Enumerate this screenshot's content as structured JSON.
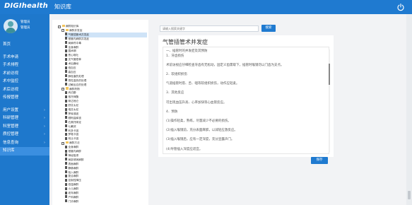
{
  "header": {
    "logo": "DIGIhealth",
    "title": "知识库",
    "power_icon": "power-icon"
  },
  "user": {
    "name": "管理员",
    "role": "管理员"
  },
  "sidebar": {
    "items": [
      {
        "label": "首页",
        "chevron": "",
        "active": false
      },
      {
        "label": "手术申请",
        "chevron": "",
        "active": false
      },
      {
        "label": "手术排程",
        "chevron": "",
        "active": false
      },
      {
        "label": "术前访视",
        "chevron": "",
        "active": false
      },
      {
        "label": "术中监控",
        "chevron": "",
        "active": false
      },
      {
        "label": "术后访视",
        "chevron": "",
        "active": false
      },
      {
        "label": "传报管理",
        "chevron": "",
        "active": false
      },
      {
        "label": "用户设置",
        "chevron": "›",
        "active": false
      },
      {
        "label": "科研管理",
        "chevron": "›",
        "active": false
      },
      {
        "label": "科室管理",
        "chevron": "›",
        "active": false
      },
      {
        "label": "质控管理",
        "chevron": "›",
        "active": false
      },
      {
        "label": "信息查询",
        "chevron": "›",
        "active": false
      },
      {
        "label": "知识库",
        "chevron": "",
        "active": true
      }
    ]
  },
  "tree": {
    "rows": [
      {
        "indent": 0,
        "icon": "box",
        "label": "麻醉知识库",
        "selected": false
      },
      {
        "indent": 1,
        "icon": "box",
        "label": "麻醉并发症",
        "selected": false
      },
      {
        "indent": 2,
        "icon": "doc",
        "label": "气管插管术并发症",
        "selected": true
      },
      {
        "indent": 2,
        "icon": "doc",
        "label": "椎管内麻醉并发症",
        "selected": false
      },
      {
        "indent": 2,
        "icon": "doc",
        "label": "局麻药中毒",
        "selected": false
      },
      {
        "indent": 2,
        "icon": "doc",
        "label": "全身麻醉",
        "selected": false
      },
      {
        "indent": 2,
        "icon": "doc",
        "label": "围术期",
        "selected": false
      },
      {
        "indent": 2,
        "icon": "doc",
        "label": "恶心呕吐",
        "selected": false
      },
      {
        "indent": 2,
        "icon": "doc",
        "label": "支气管痉挛",
        "selected": false
      },
      {
        "indent": 2,
        "icon": "doc",
        "label": "术后躁动",
        "selected": false
      },
      {
        "indent": 2,
        "icon": "doc",
        "label": "低血压",
        "selected": false
      },
      {
        "indent": 2,
        "icon": "doc",
        "label": "高血压",
        "selected": false
      },
      {
        "indent": 2,
        "icon": "doc",
        "label": "肺栓塞的处理",
        "selected": false
      },
      {
        "indent": 2,
        "icon": "doc",
        "label": "恶性高热的处理",
        "selected": false
      },
      {
        "indent": 2,
        "icon": "doc",
        "label": "过敏反应的处理",
        "selected": false
      },
      {
        "indent": 1,
        "icon": "box",
        "label": "麻醉药物",
        "selected": false
      },
      {
        "indent": 2,
        "icon": "doc",
        "label": "丙泊酚",
        "selected": false
      },
      {
        "indent": 2,
        "icon": "doc",
        "label": "依托咪酯",
        "selected": false
      },
      {
        "indent": 2,
        "icon": "doc",
        "label": "咪达唑仑",
        "selected": false
      },
      {
        "indent": 2,
        "icon": "doc",
        "label": "舒芬太尼",
        "selected": false
      },
      {
        "indent": 2,
        "icon": "doc",
        "label": "瑞芬太尼",
        "selected": false
      },
      {
        "indent": 2,
        "icon": "doc",
        "label": "罗库溴铵",
        "selected": false
      },
      {
        "indent": 2,
        "icon": "doc",
        "label": "顺阿曲库铵",
        "selected": false
      },
      {
        "indent": 2,
        "icon": "doc",
        "label": "右美托咪定",
        "selected": false
      },
      {
        "indent": 2,
        "icon": "doc",
        "label": "七氟烷",
        "selected": false
      },
      {
        "indent": 2,
        "icon": "doc",
        "label": "利多卡因",
        "selected": false
      },
      {
        "indent": 2,
        "icon": "doc",
        "label": "罗哌卡因",
        "selected": false
      },
      {
        "indent": 2,
        "icon": "doc",
        "label": "布比卡因",
        "selected": false
      },
      {
        "indent": 1,
        "icon": "box",
        "label": "麻醉方法",
        "selected": false
      },
      {
        "indent": 2,
        "icon": "doc",
        "label": "全身麻醉",
        "selected": false
      },
      {
        "indent": 2,
        "icon": "doc",
        "label": "椎管内麻醉",
        "selected": false
      },
      {
        "indent": 2,
        "icon": "doc",
        "label": "神经阻滞",
        "selected": false
      },
      {
        "indent": 2,
        "icon": "doc",
        "label": "局部浸润麻醉",
        "selected": false
      },
      {
        "indent": 2,
        "icon": "doc",
        "label": "表面麻醉",
        "selected": false
      },
      {
        "indent": 2,
        "icon": "doc",
        "label": "静脉麻醉",
        "selected": false
      },
      {
        "indent": 2,
        "icon": "doc",
        "label": "吸入麻醉",
        "selected": false
      },
      {
        "indent": 2,
        "icon": "doc",
        "label": "复合麻醉",
        "selected": false
      },
      {
        "indent": 2,
        "icon": "doc",
        "label": "控制性降压",
        "selected": false
      },
      {
        "indent": 2,
        "icon": "doc",
        "label": "低温麻醉",
        "selected": false
      },
      {
        "indent": 2,
        "icon": "doc",
        "label": "小儿麻醉",
        "selected": false
      },
      {
        "indent": 2,
        "icon": "doc",
        "label": "老年麻醉",
        "selected": false
      },
      {
        "indent": 2,
        "icon": "doc",
        "label": "产科麻醉",
        "selected": false
      },
      {
        "indent": 2,
        "icon": "doc",
        "label": "门诊麻醉",
        "selected": false
      }
    ]
  },
  "search": {
    "placeholder": "请输入搜索关键字",
    "button_label": "搜索"
  },
  "article": {
    "title": "气管插管术并发症",
    "lines": [
      "一、插管时的并发症及其预防",
      "1．牙齿损伤",
      "",
      "术前访视应仔细检查牙齿有无松动，固定义齿需取下，插管时喉镜勿以门齿为支点。",
      "",
      "2．软组织损伤",
      "",
      "气道插管时唇、舌、咽等软组织损伤，动作应轻柔。",
      "",
      "3．其他反应",
      "",
      "可出现血压升高、心率加快等心血管反应。",
      "",
      "4．预防",
      "",
      "(1)操作轻柔，熟练，尽量减少不必要的损伤。",
      "",
      "(2)插入喉镜前，充分表面麻醉，以减轻应激反应。",
      "",
      "(3)插入喉镜后，应有一定深度，充分显露声门。",
      "",
      "(4)导管插入深度应适宜。"
    ],
    "save_label": "保存"
  }
}
